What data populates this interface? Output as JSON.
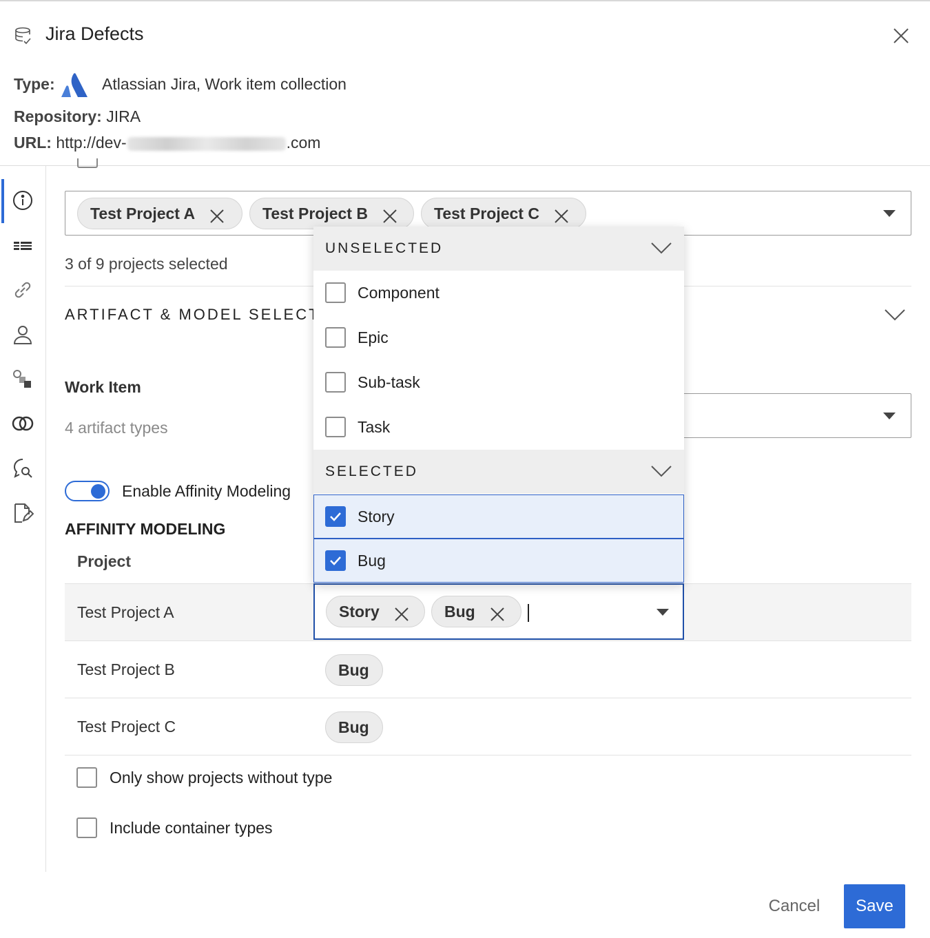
{
  "header": {
    "title": "Jira Defects",
    "type_label": "Type:",
    "type_value": "Atlassian Jira, Work item collection",
    "repository_label": "Repository:",
    "repository_value": "JIRA",
    "url_label": "URL:",
    "url_prefix": "http://dev-",
    "url_suffix": ".com"
  },
  "rail": {
    "icons": [
      "info-icon",
      "list-icon",
      "link-icon",
      "person-icon",
      "shapes-icon",
      "overlap-icon",
      "chat-search-icon",
      "document-edit-icon"
    ],
    "active": "info-icon"
  },
  "projects": {
    "chips": [
      "Test Project A",
      "Test Project B",
      "Test Project C"
    ],
    "count_text": "3 of 9 projects selected"
  },
  "section": {
    "title": "ARTIFACT & MODEL SELECTIO"
  },
  "work_item": {
    "label": "Work Item",
    "subtitle": "4 artifact types"
  },
  "affinity": {
    "toggle_label": "Enable Affinity Modeling",
    "toggle_on": true,
    "title": "AFFINITY MODELING",
    "column_header": "Project",
    "rows": [
      {
        "name": "Test Project A",
        "types": [
          "Story",
          "Bug"
        ]
      },
      {
        "name": "Test Project B",
        "types": [
          "Bug"
        ]
      },
      {
        "name": "Test Project C",
        "types": [
          "Bug"
        ]
      }
    ]
  },
  "dropdown": {
    "unselected_header": "UNSELECTED",
    "unselected": [
      "Component",
      "Epic",
      "Sub-task",
      "Task"
    ],
    "selected_header": "SELECTED",
    "selected": [
      "Story",
      "Bug"
    ]
  },
  "options": {
    "only_without_type": "Only show projects without type",
    "include_container": "Include container types"
  },
  "footer": {
    "cancel": "Cancel",
    "save": "Save"
  },
  "colors": {
    "accent": "#2d6bd6",
    "focus_border": "#1f4fa8",
    "selected_bg": "#e8effa"
  }
}
